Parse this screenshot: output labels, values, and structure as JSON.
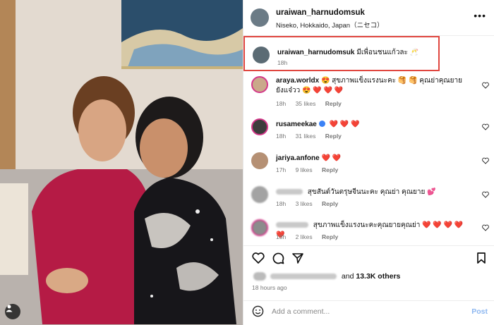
{
  "post": {
    "author": "uraiwan_harnudomsuk",
    "location": "Niseko, Hokkaido, Japan（ニセコ）",
    "more_icon": "more-horizontal-icon"
  },
  "caption": {
    "author": "uraiwan_harnudomsuk",
    "text": "มีเพื่อนชนแก้วละ 🥂",
    "time": "18h"
  },
  "comments": [
    {
      "user": "araya.worldx",
      "text": "😍 สุขภาพแข็งแรงนะคะ 🥞 🥞 คุณย่าคุณยายยังแจ๋วว",
      "hearts": "😍 ❤️ ❤️ ❤️",
      "time": "18h",
      "likes": "35 likes",
      "reply": "Reply"
    },
    {
      "user": "rusameekae",
      "text": "",
      "hearts": "❤️ ❤️ ❤️",
      "time": "18h",
      "likes": "31 likes",
      "reply": "Reply"
    },
    {
      "user": "jariya.anfone",
      "text": "",
      "hearts": "❤️ ❤️",
      "time": "17h",
      "likes": "9 likes",
      "reply": "Reply"
    },
    {
      "user": "",
      "text": "สุขสันต์วันตรุษจีนนะคะ คุณย่า คุณยาย",
      "hearts": "💕",
      "time": "18h",
      "likes": "3 likes",
      "reply": "Reply"
    },
    {
      "user": "",
      "text": "สุขภาพแข็งแรงนะคะคุณยายคุณย่า",
      "hearts": "❤️ ❤️ ❤️ ❤️ ❤️",
      "time": "18h",
      "likes": "2 likes",
      "reply": "Reply"
    }
  ],
  "actions": {
    "like_icon": "heart-icon",
    "comment_icon": "comment-icon",
    "share_icon": "share-icon",
    "save_icon": "bookmark-icon"
  },
  "likes_summary": {
    "suffix": "and",
    "count": "13.3K others"
  },
  "posted_ago": "18 hours ago",
  "add_comment": {
    "placeholder": "Add a comment...",
    "post_label": "Post",
    "emoji_icon": "emoji-icon"
  },
  "colors": {
    "highlight_border": "#e0463f",
    "heart": "#e0245e",
    "link_post": "#8db7f0",
    "verified": "#3b82f6"
  }
}
